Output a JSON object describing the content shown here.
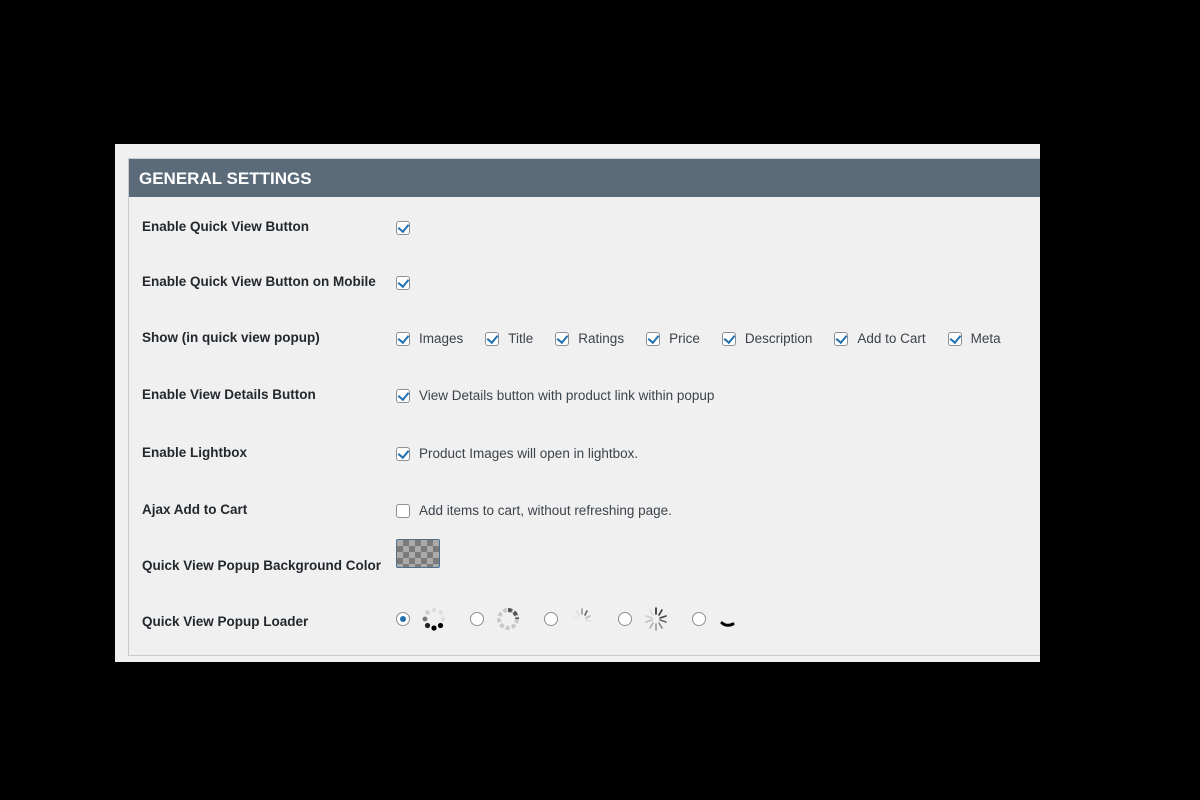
{
  "header": {
    "title": "GENERAL SETTINGS"
  },
  "rows": {
    "quick_view": {
      "label": "Enable Quick View Button",
      "checked": true
    },
    "quick_view_mobile": {
      "label": "Enable Quick View Button on Mobile",
      "checked": true
    },
    "show": {
      "label": "Show (in quick view popup)",
      "options": [
        {
          "label": "Images",
          "checked": true
        },
        {
          "label": "Title",
          "checked": true
        },
        {
          "label": "Ratings",
          "checked": true
        },
        {
          "label": "Price",
          "checked": true
        },
        {
          "label": "Description",
          "checked": true
        },
        {
          "label": "Add to Cart",
          "checked": true
        },
        {
          "label": "Meta",
          "checked": true
        }
      ]
    },
    "view_details": {
      "label": "Enable View Details Button",
      "checked": true,
      "text": "View Details button with product link within popup"
    },
    "lightbox": {
      "label": "Enable Lightbox",
      "checked": true,
      "text": "Product Images will open in lightbox."
    },
    "ajax_cart": {
      "label": "Ajax Add to Cart",
      "checked": false,
      "text": "Add items to cart, without refreshing page."
    },
    "bg_color": {
      "label": "Quick View Popup Background Color"
    },
    "loader": {
      "label": "Quick View Popup Loader",
      "selected_index": 0,
      "icons": [
        "dots-spinner-icon",
        "ring-spinner-icon",
        "faint-spinner-icon",
        "lines-spinner-icon",
        "arc-spinner-icon"
      ]
    }
  },
  "colors": {
    "header_bg": "#5b6b7a",
    "accent": "#2271b1"
  }
}
